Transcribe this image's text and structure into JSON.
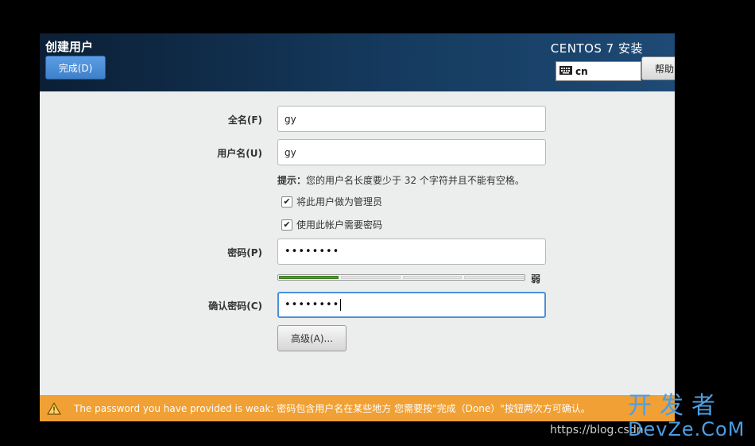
{
  "header": {
    "title": "创建用户",
    "done_label": "完成(D)",
    "product_title": "CENTOS 7 安装",
    "keyboard_layout": "cn",
    "help_label": "帮助"
  },
  "form": {
    "fullname_label": "全名(F)",
    "fullname_value": "gy",
    "username_label": "用户名(U)",
    "username_value": "gy",
    "hint_prefix": "提示：",
    "hint_text": "您的用户名长度要少于 32 个字符并且不能有空格。",
    "admin_checkbox_label": "将此用户做为管理员",
    "admin_checked": true,
    "require_password_label": "使用此帐户需要密码",
    "require_password_checked": true,
    "password_label": "密码(P)",
    "password_mask": "••••••••",
    "strength_fraction": 0.25,
    "strength_label": "弱",
    "confirm_label": "确认密码(C)",
    "confirm_mask": "••••••••",
    "advanced_label": "高级(A)..."
  },
  "warning": {
    "text": "The password you have provided is weak: 密码包含用户名在某些地方 您需要按\"完成（Done）\"按钮两次方可确认。"
  },
  "watermark": {
    "url": "https://blog.csdn",
    "cn": "开发者",
    "en": "DevZe.CoM"
  },
  "colors": {
    "header_bg": "#153a5e",
    "done_button": "#4a8ad6",
    "warning_bar": "#f0a034",
    "strength_fill": "#4f9a2e",
    "focus_border": "#4a90d9"
  }
}
